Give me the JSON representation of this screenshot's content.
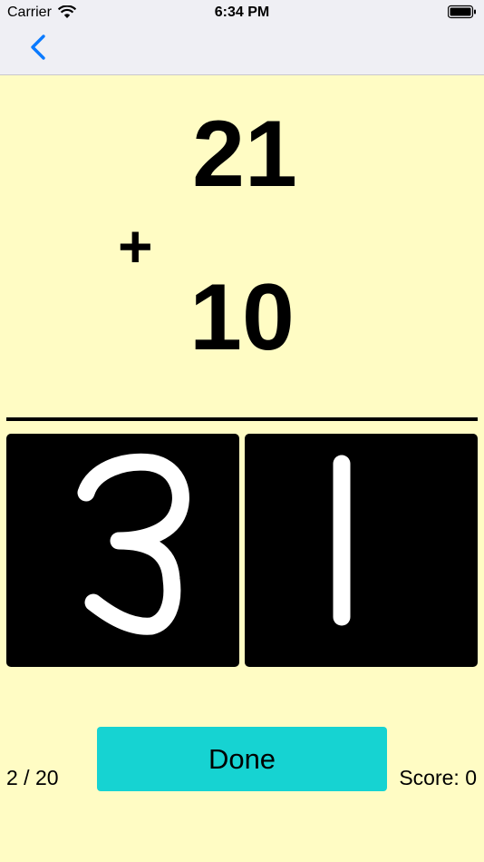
{
  "status_bar": {
    "carrier": "Carrier",
    "time": "6:34 PM",
    "wifi_icon": "wifi-icon",
    "battery_icon": "battery-icon"
  },
  "nav": {
    "back_icon": "chevron-left-icon",
    "accent_color": "#0a7aff"
  },
  "problem": {
    "top_operand": "21",
    "operator": "+",
    "bottom_operand": "10"
  },
  "answer": {
    "digits": [
      "3",
      "1"
    ]
  },
  "footer": {
    "progress": "2 / 20",
    "done_label": "Done",
    "score": "Score: 0",
    "done_color": "#16d3d2"
  },
  "colors": {
    "background": "#fffcc4",
    "bar": "#efeff4"
  }
}
